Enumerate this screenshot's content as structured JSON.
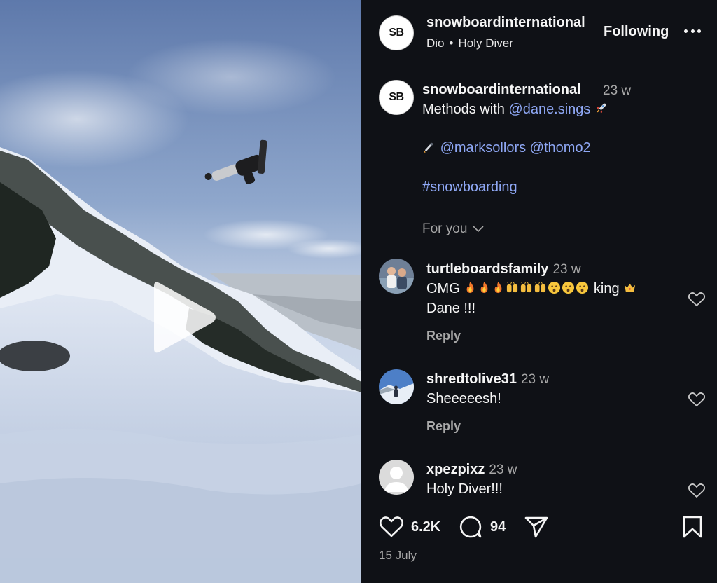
{
  "post": {
    "username": "snowboardinternational",
    "avatar_text": "SB",
    "audio_artist": "Dio",
    "audio_separator": "•",
    "audio_track": "Holy Diver",
    "follow_label": "Following",
    "more_icon": "more-horizontal-icon"
  },
  "caption": {
    "username": "snowboardinternational",
    "time": "23 w",
    "line1_text": "Methods with ",
    "line1_mention": "@dane.sings",
    "line1_emoji": "rocket",
    "line2_emoji": "camera",
    "line2_mention1": "@marksollors",
    "line2_mention2": "@thomo2",
    "hashtag": "#snowboarding",
    "for_you_label": "For you"
  },
  "comments": [
    {
      "username": "turtleboardsfamily",
      "time": "23 w",
      "text_before": "OMG ",
      "emojis": [
        "fire",
        "fire",
        "fire",
        "raised-hands",
        "raised-hands",
        "raised-hands",
        "astonished",
        "astonished",
        "astonished"
      ],
      "text_after": " king ",
      "end_emoji": "crown",
      "text_line2": "Dane !!!",
      "reply_label": "Reply"
    },
    {
      "username": "shredtolive31",
      "time": "23 w",
      "text": "Sheeeeesh!",
      "reply_label": "Reply"
    },
    {
      "username": "xpezpixz",
      "time": "23 w",
      "text": "Holy Diver!!!"
    }
  ],
  "footer": {
    "likes": "6.2K",
    "comments": "94",
    "date": "15 July"
  },
  "colors": {
    "panel_bg": "#0f1116",
    "link": "#8fa8f5",
    "muted": "#a8a8a8"
  }
}
